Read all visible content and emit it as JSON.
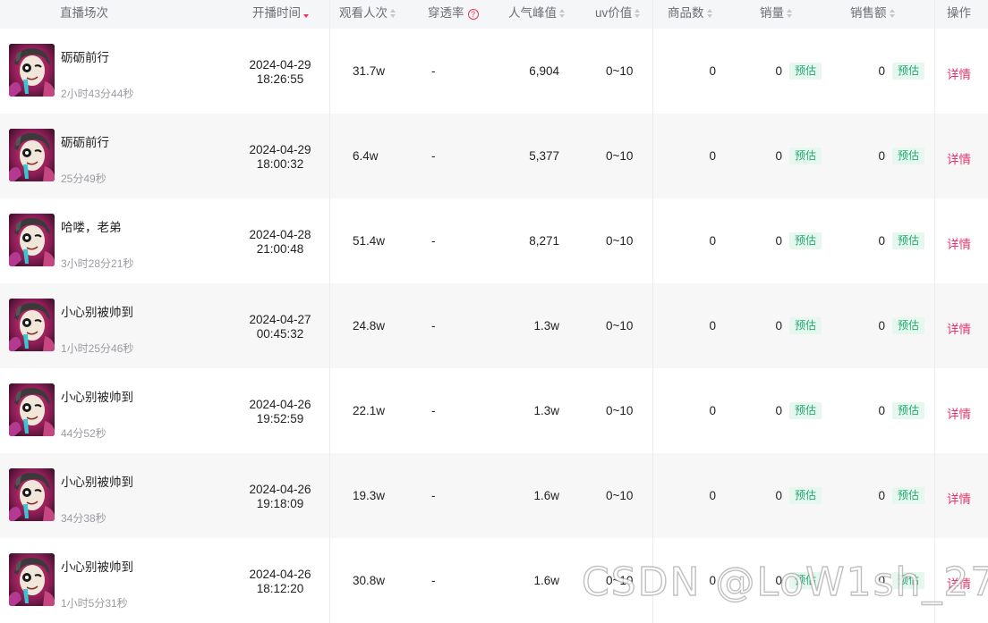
{
  "header": {
    "col_session": "直播场次",
    "col_start_time": "开播时间",
    "col_views": "观看人次",
    "col_penetration": "穿透率",
    "col_peak": "人气峰值",
    "col_uv": "uv价值",
    "col_products": "商品数",
    "col_sales": "销量",
    "col_revenue": "销售额",
    "col_action": "操作",
    "help_glyph": "?"
  },
  "rows": [
    {
      "title": "砺砺前行",
      "duration": "2小时43分44秒",
      "date": "2024-04-29",
      "time": "18:26:55",
      "views": "31.7w",
      "penetration": "-",
      "peak": "6,904",
      "uv": "0~10",
      "products": "0",
      "sales": "0",
      "sales_badge": "预估",
      "revenue": "0",
      "revenue_badge": "预估",
      "action": "详情"
    },
    {
      "title": "砺砺前行",
      "duration": "25分49秒",
      "date": "2024-04-29",
      "time": "18:00:32",
      "views": "6.4w",
      "penetration": "-",
      "peak": "5,377",
      "uv": "0~10",
      "products": "0",
      "sales": "0",
      "sales_badge": "预估",
      "revenue": "0",
      "revenue_badge": "预估",
      "action": "详情"
    },
    {
      "title": "哈喽，老弟",
      "duration": "3小时28分21秒",
      "date": "2024-04-28",
      "time": "21:00:48",
      "views": "51.4w",
      "penetration": "-",
      "peak": "8,271",
      "uv": "0~10",
      "products": "0",
      "sales": "0",
      "sales_badge": "预估",
      "revenue": "0",
      "revenue_badge": "预估",
      "action": "详情"
    },
    {
      "title": "小心别被帅到",
      "duration": "1小时25分46秒",
      "date": "2024-04-27",
      "time": "00:45:32",
      "views": "24.8w",
      "penetration": "-",
      "peak": "1.3w",
      "uv": "0~10",
      "products": "0",
      "sales": "0",
      "sales_badge": "预估",
      "revenue": "0",
      "revenue_badge": "预估",
      "action": "详情"
    },
    {
      "title": "小心别被帅到",
      "duration": "44分52秒",
      "date": "2024-04-26",
      "time": "19:52:59",
      "views": "22.1w",
      "penetration": "-",
      "peak": "1.3w",
      "uv": "0~10",
      "products": "0",
      "sales": "0",
      "sales_badge": "预估",
      "revenue": "0",
      "revenue_badge": "预估",
      "action": "详情"
    },
    {
      "title": "小心别被帅到",
      "duration": "34分38秒",
      "date": "2024-04-26",
      "time": "19:18:09",
      "views": "19.3w",
      "penetration": "-",
      "peak": "1.6w",
      "uv": "0~10",
      "products": "0",
      "sales": "0",
      "sales_badge": "预估",
      "revenue": "0",
      "revenue_badge": "预估",
      "action": "详情"
    },
    {
      "title": "小心别被帅到",
      "duration": "1小时5分31秒",
      "date": "2024-04-26",
      "time": "18:12:20",
      "views": "30.8w",
      "penetration": "-",
      "peak": "1.6w",
      "uv": "0~10",
      "products": "0",
      "sales": "0",
      "sales_badge": "预估",
      "revenue": "0",
      "revenue_badge": "预估",
      "action": "详情"
    }
  ],
  "watermark": "CSDN @LoW1sh_27",
  "colors": {
    "accent": "#f0325c",
    "link": "#e8336a",
    "badge_text": "#22a870",
    "badge_bg": "#e6f7ef",
    "header_bg": "#f5f6f8",
    "alt_row_bg": "#f7f7f8"
  },
  "icons": {
    "sort": "sort-caret-icon",
    "sort_active": "sort-desc-icon",
    "help": "help-circle-icon"
  }
}
